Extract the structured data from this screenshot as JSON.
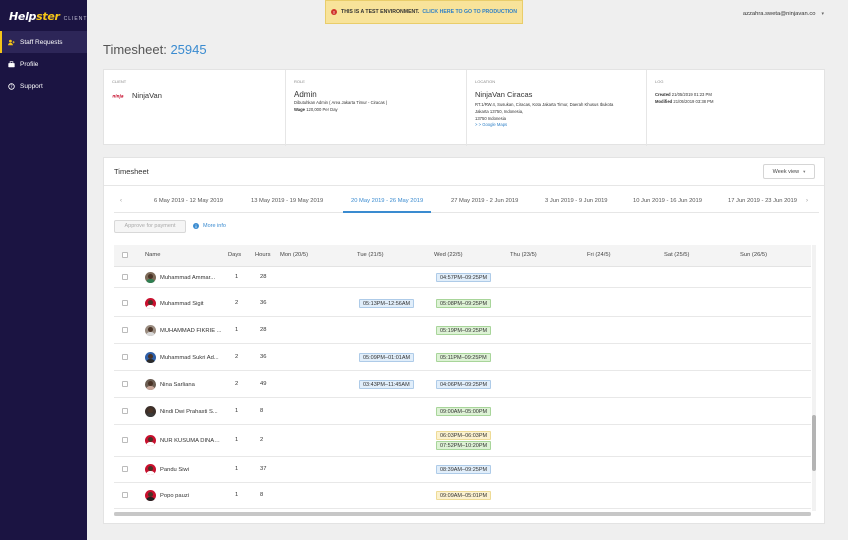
{
  "brand": {
    "name_part1": "Help",
    "name_part2": "ster",
    "suffix": "CLIENT"
  },
  "sidebar": {
    "items": [
      {
        "label": "Staff Requests",
        "icon": "staff-icon",
        "active": true
      },
      {
        "label": "Profile",
        "icon": "briefcase-icon",
        "active": false
      },
      {
        "label": "Support",
        "icon": "help-icon",
        "active": false
      }
    ]
  },
  "banner": {
    "text": "THIS IS A TEST ENVIRONMENT.",
    "link": "CLICK HERE TO GO TO PRODUCTION",
    "icon": "warning-icon"
  },
  "user": {
    "email": "azzahra.sweta@ninjavan.co"
  },
  "page": {
    "title": "Timesheet:",
    "id": "25945"
  },
  "info": {
    "client": {
      "label": "CLIENT",
      "name": "NinjaVan",
      "logo_text": "ninja"
    },
    "role": {
      "label": "ROLE",
      "name": "Admin",
      "created_by": "Dibutuhkan Admin ( Area Jakarta Timur - Ciracas )",
      "wage_label": "Wage",
      "wage_value": "120,000 Per Day"
    },
    "location": {
      "label": "LOCATION",
      "name": "NinjaVan Ciracas",
      "address_line1": "RT.1/RW.4, Susukan, Ciracas, Kota Jakarta Timur, Daerah Khusus Ibukota",
      "address_line2": "Jakarta 13750, Indonesia,",
      "address_line3": "13750 Indonesia",
      "maps_link": "> > Google Maps"
    },
    "log": {
      "label": "LOG",
      "created_label": "Created",
      "created_value": "21/05/2019 01:23 PM",
      "modified_label": "Modified",
      "modified_value": "21/05/2019 03:38 PM"
    }
  },
  "timesheet": {
    "title": "Timesheet",
    "view_select": "Week view",
    "weeks": [
      "6 May 2019 - 12 May 2019",
      "13 May 2019 - 19 May 2019",
      "20 May 2019 - 26 May 2019",
      "27 May 2019 - 2 Jun 2019",
      "3 Jun 2019 - 9 Jun 2019",
      "10 Jun 2019 - 16 Jun 2019",
      "17 Jun 2019 - 23 Jun 2019"
    ],
    "active_week_index": 2,
    "approve_label": "Approve for payment",
    "more_info_label": "More info",
    "columns": {
      "name": "Name",
      "days": "Days",
      "hours": "Hours",
      "mon": "Mon (20/5)",
      "tue": "Tue (21/5)",
      "wed": "Wed (22/5)",
      "thu": "Thu (23/5)",
      "fri": "Fri (24/5)",
      "sat": "Sat (25/5)",
      "sun": "Sun (26/5)"
    },
    "rows": [
      {
        "name": "Muhammad Ammar...",
        "days": "1",
        "hours": "28",
        "tue": "",
        "wed": [
          "04:57PM–09:25PM"
        ],
        "wed_color": "blue"
      },
      {
        "name": "Muhammad Sigit",
        "days": "2",
        "hours": "36",
        "tue": "05:13PM–12:56AM",
        "wed": [
          "05:08PM–09:25PM"
        ],
        "wed_color": "green"
      },
      {
        "name": "MUHAMMAD FIKRIE ...",
        "days": "1",
        "hours": "28",
        "tue": "",
        "wed": [
          "05:19PM–09:25PM"
        ],
        "wed_color": "green"
      },
      {
        "name": "Muhammad Sukri Ad...",
        "days": "2",
        "hours": "36",
        "tue": "05:09PM–01:01AM",
        "wed": [
          "05:11PM–09:25PM"
        ],
        "wed_color": "green"
      },
      {
        "name": "Nina Sarliana",
        "days": "2",
        "hours": "49",
        "tue": "03:43PM–11:45AM",
        "wed": [
          "04:06PM–09:25PM"
        ],
        "wed_color": "blue"
      },
      {
        "name": "Nindi Dwi Prahasti S...",
        "days": "1",
        "hours": "8",
        "tue": "",
        "wed": [
          "09:00AM–05:00PM"
        ],
        "wed_color": "green"
      },
      {
        "name": "NUR KUSUMA DINARTI",
        "days": "1",
        "hours": "2",
        "tue": "",
        "wed": [
          "06:03PM–06:03PM",
          "07:52PM–10:20PM"
        ],
        "wed_color": "yellow-green"
      },
      {
        "name": "Pandu Siwi",
        "days": "1",
        "hours": "37",
        "tue": "",
        "wed": [
          "08:39AM–09:25PM"
        ],
        "wed_color": "blue"
      },
      {
        "name": "Popo pauzi",
        "days": "1",
        "hours": "8",
        "tue": "",
        "wed": [
          "09:09AM–05:01PM"
        ],
        "wed_color": "yellow"
      }
    ]
  },
  "colors": {
    "sidebar_bg": "#1b1442",
    "accent": "#3a8bd0",
    "brand_yellow": "#f5c518"
  }
}
